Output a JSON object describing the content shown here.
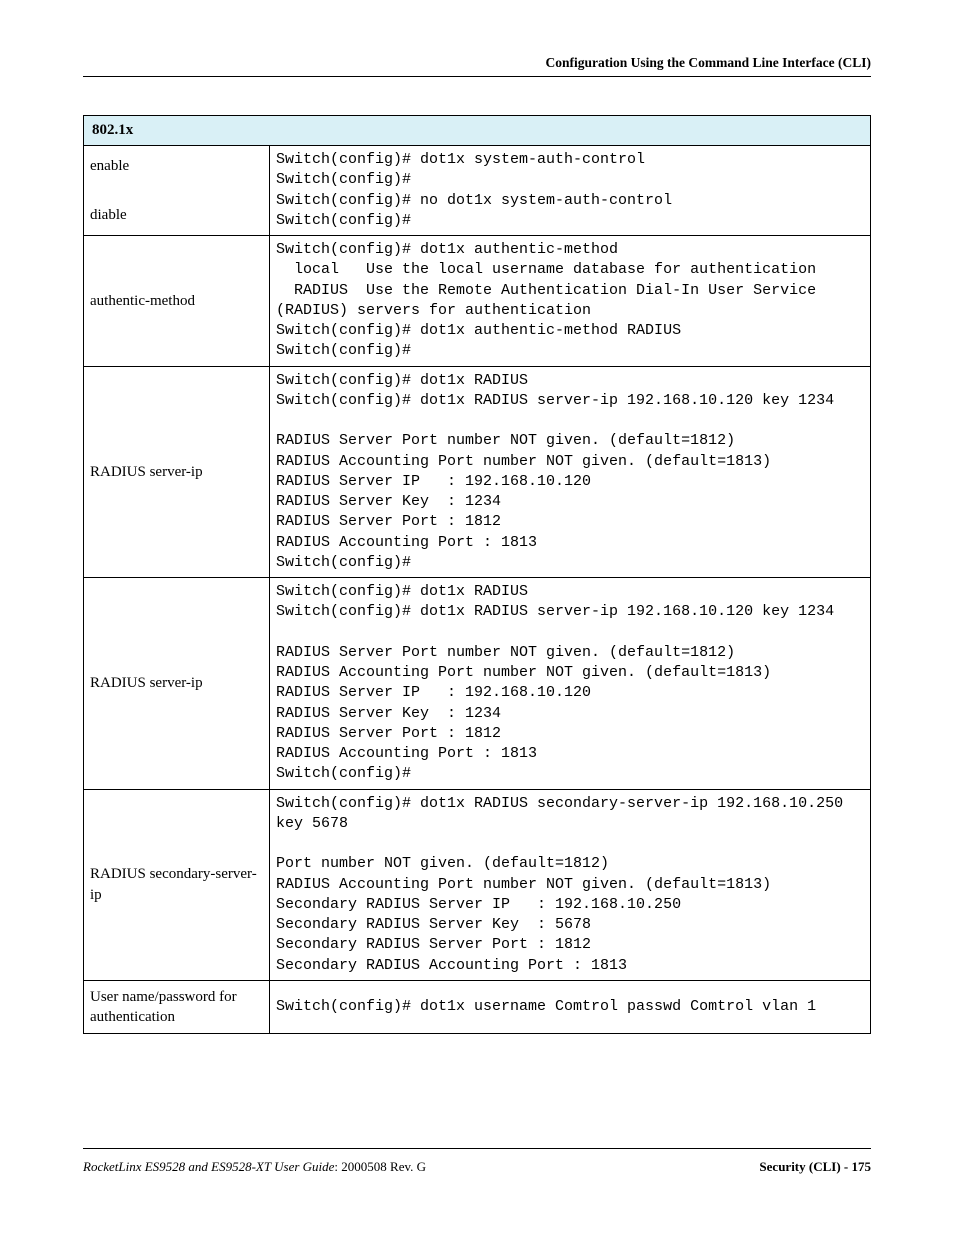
{
  "header": {
    "running_title": "Configuration Using the Command Line Interface (CLI)"
  },
  "table": {
    "title": "802.1x",
    "rows": [
      {
        "labels": [
          "enable",
          "diable"
        ],
        "code": "Switch(config)# dot1x system-auth-control\nSwitch(config)#\nSwitch(config)# no dot1x system-auth-control\nSwitch(config)#"
      },
      {
        "labels": [
          "authentic-method"
        ],
        "code": "Switch(config)# dot1x authentic-method\n  local   Use the local username database for authentication\n  RADIUS  Use the Remote Authentication Dial-In User Service\n(RADIUS) servers for authentication\nSwitch(config)# dot1x authentic-method RADIUS\nSwitch(config)#"
      },
      {
        "labels": [
          "RADIUS server-ip"
        ],
        "code": "Switch(config)# dot1x RADIUS\nSwitch(config)# dot1x RADIUS server-ip 192.168.10.120 key 1234\n\nRADIUS Server Port number NOT given. (default=1812)\nRADIUS Accounting Port number NOT given. (default=1813)\nRADIUS Server IP   : 192.168.10.120\nRADIUS Server Key  : 1234\nRADIUS Server Port : 1812\nRADIUS Accounting Port : 1813\nSwitch(config)#"
      },
      {
        "labels": [
          "RADIUS server-ip"
        ],
        "code": "Switch(config)# dot1x RADIUS\nSwitch(config)# dot1x RADIUS server-ip 192.168.10.120 key 1234\n\nRADIUS Server Port number NOT given. (default=1812)\nRADIUS Accounting Port number NOT given. (default=1813)\nRADIUS Server IP   : 192.168.10.120\nRADIUS Server Key  : 1234\nRADIUS Server Port : 1812\nRADIUS Accounting Port : 1813\nSwitch(config)#"
      },
      {
        "labels": [
          "RADIUS secondary-server-ip"
        ],
        "code": "Switch(config)# dot1x RADIUS secondary-server-ip 192.168.10.250 \nkey 5678\n\nPort number NOT given. (default=1812)\nRADIUS Accounting Port number NOT given. (default=1813)\nSecondary RADIUS Server IP   : 192.168.10.250\nSecondary RADIUS Server Key  : 5678\nSecondary RADIUS Server Port : 1812\nSecondary RADIUS Accounting Port : 1813"
      },
      {
        "labels": [
          "User name/password for authentication"
        ],
        "label_valign": "top",
        "code": "Switch(config)# dot1x username Comtrol passwd Comtrol vlan 1"
      }
    ]
  },
  "footer": {
    "guide_title": "RocketLinx ES9528 and ES9528-XT User Guide",
    "rev": ": 2000508 Rev. G",
    "section": "Security (CLI) - 175"
  }
}
